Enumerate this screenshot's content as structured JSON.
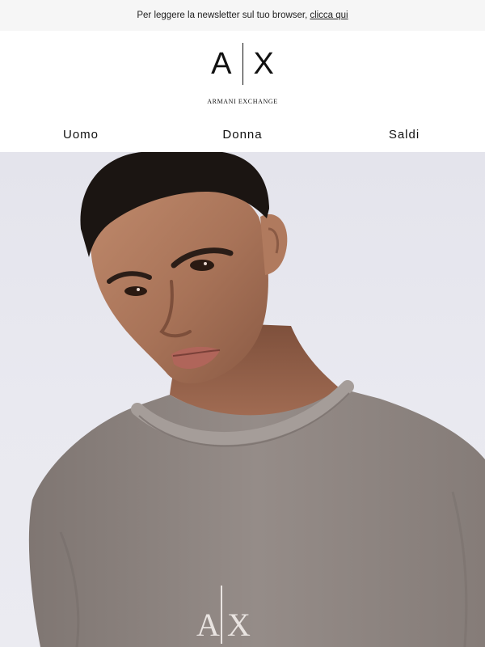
{
  "topbar": {
    "text": "Per leggere la newsletter sul tuo browser,",
    "link_label": "clicca qui"
  },
  "brand": {
    "logo_left": "A",
    "logo_right": "X",
    "wordmark": "ARMANI EXCHANGE"
  },
  "nav": {
    "items": [
      {
        "label": "Uomo"
      },
      {
        "label": "Donna"
      },
      {
        "label": "Saldi"
      }
    ]
  },
  "hero": {
    "shirt_logo_left": "A",
    "shirt_logo_right": "X",
    "colors": {
      "background": "#e8e8ef",
      "skin": "#b07a5e",
      "hair": "#1b1512",
      "shirt": "#8f8682"
    }
  }
}
